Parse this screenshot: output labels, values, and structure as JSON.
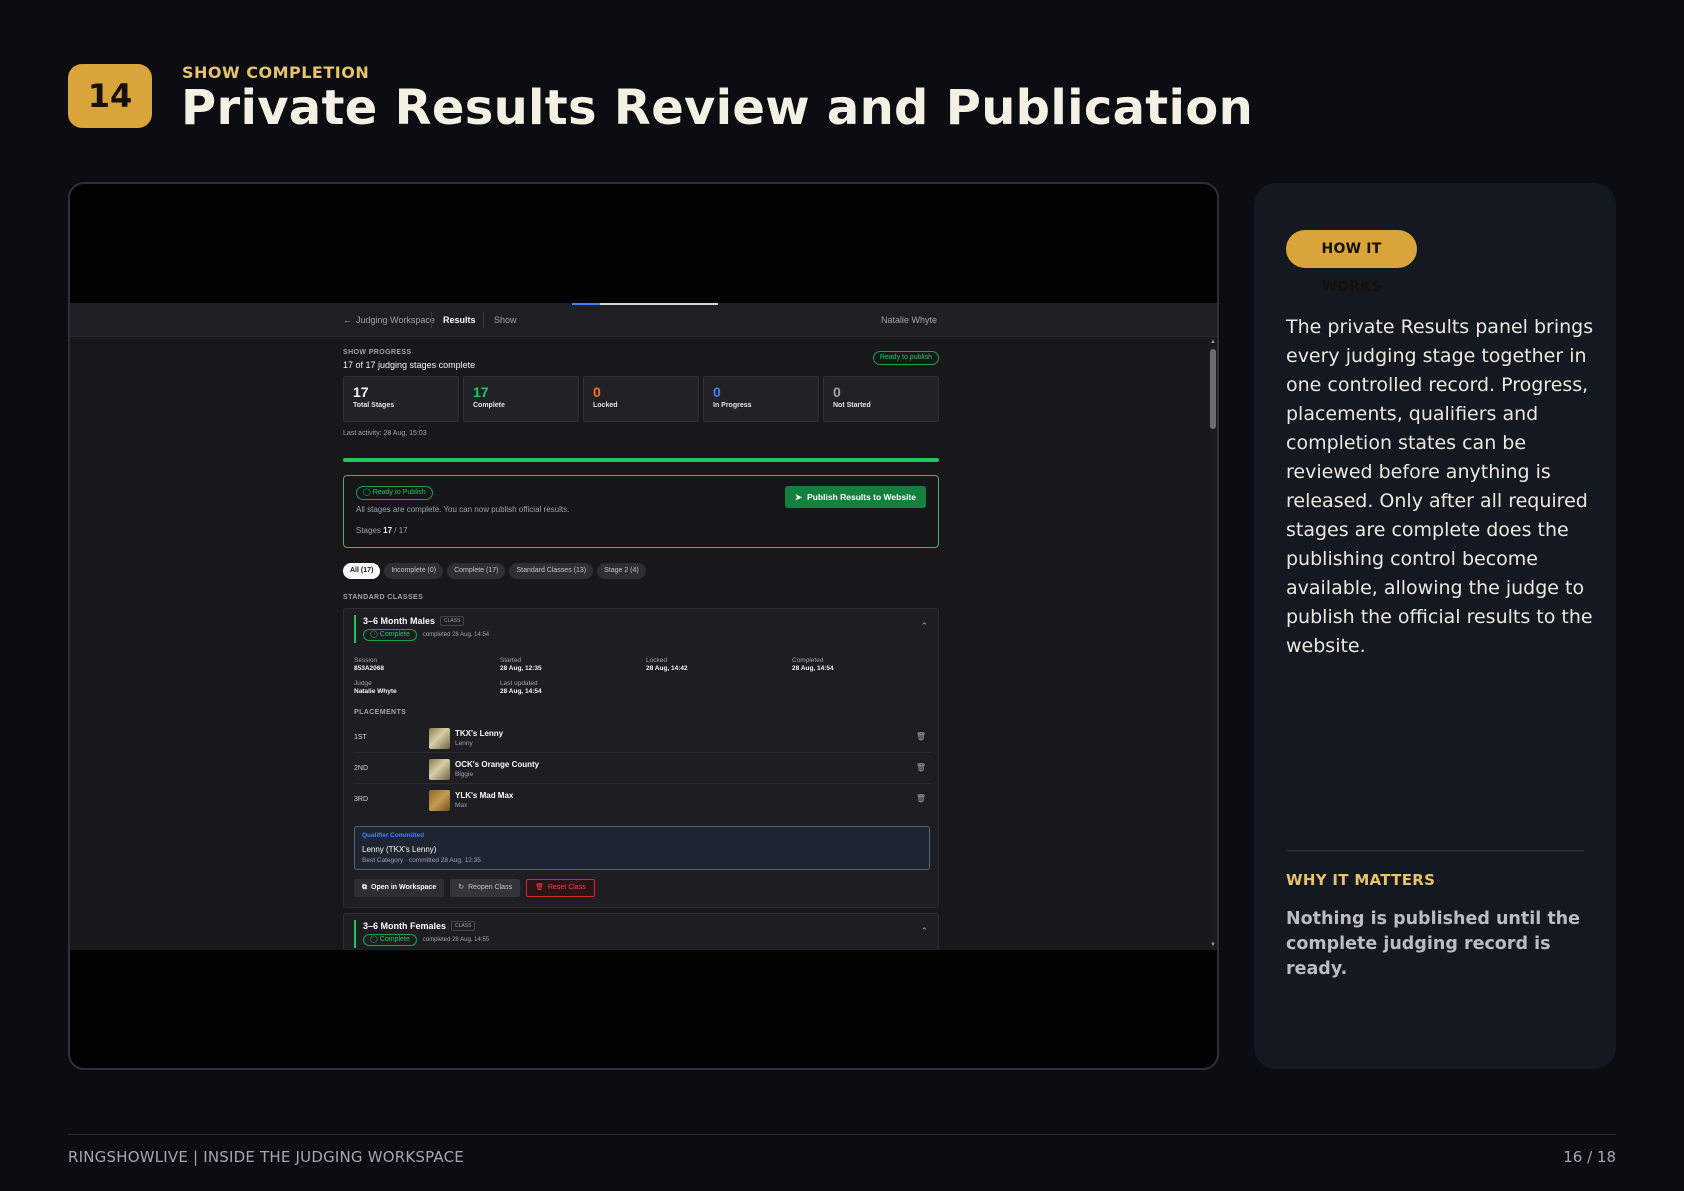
{
  "slide": {
    "number": "14",
    "eyebrow": "SHOW COMPLETION",
    "title": "Private Results Review and Publication"
  },
  "app": {
    "nav": {
      "back_label": "Judging Workspace",
      "results": "Results",
      "show": "Show",
      "user": "Natalie Whyte"
    },
    "progress": {
      "section_label": "SHOW PROGRESS",
      "summary": "17 of 17 judging stages complete",
      "ready_pill": "Ready to publish",
      "percent_complete": 100,
      "stats": [
        {
          "value": "17",
          "label": "Total Stages",
          "color": "#fafafa"
        },
        {
          "value": "17",
          "label": "Complete",
          "color": "#22c55e"
        },
        {
          "value": "0",
          "label": "Locked",
          "color": "#f97316"
        },
        {
          "value": "0",
          "label": "In Progress",
          "color": "#3b82f6"
        },
        {
          "value": "0",
          "label": "Not Started",
          "color": "#a1a1aa"
        }
      ],
      "last_activity": "Last activity: 28 Aug, 15:03"
    },
    "publish": {
      "badge": "Ready to Publish",
      "message": "All stages are complete. You can now publish official results.",
      "stages_prefix": "Stages",
      "stages_done": "17",
      "stages_total": "/ 17",
      "button": "Publish Results to Website"
    },
    "filters": [
      "All (17)",
      "Incomplete (0)",
      "Complete (17)",
      "Standard Classes (13)",
      "Stage 2 (4)"
    ],
    "standard_label": "STANDARD CLASSES",
    "class1": {
      "name": "3–6 Month Males",
      "tag": "CLASS",
      "status": "Complete",
      "completed": "completed 28 Aug, 14:54",
      "meta": {
        "session_k": "Session",
        "session_v": "853A2068",
        "started_k": "Started",
        "started_v": "28 Aug, 12:35",
        "locked_k": "Locked",
        "locked_v": "28 Aug, 14:42",
        "completed_k": "Completed",
        "completed_v": "28 Aug, 14:54",
        "judge_k": "Judge",
        "judge_v": "Natalie Whyte",
        "updated_k": "Last updated",
        "updated_v": "28 Aug, 14:54"
      },
      "placements_label": "PLACEMENTS",
      "placements": [
        {
          "rank": "1ST",
          "name": "TKX's Lenny",
          "sub": "Lenny"
        },
        {
          "rank": "2ND",
          "name": "OCK's Orange County",
          "sub": "Biggie"
        },
        {
          "rank": "3RD",
          "name": "YLK's Mad Max",
          "sub": "Max"
        }
      ],
      "qualifier": {
        "title": "Qualifier Committed",
        "name": "Lenny (TKX's Lenny)",
        "detail": "Best Category · committed 28 Aug, 12:35"
      },
      "actions": {
        "open": "Open in Workspace",
        "reopen": "Reopen Class",
        "reset": "Reset Class"
      }
    },
    "class2": {
      "name": "3–6 Month Females",
      "tag": "CLASS",
      "status": "Complete",
      "completed": "completed 28 Aug, 14:55"
    }
  },
  "panel": {
    "badge": "HOW IT WORKS",
    "description": "The private Results panel brings every judging stage together in one controlled record. Progress, placements, qualifiers and completion states can be reviewed before anything is released. Only after all required stages are complete does the publishing control become available, allowing the judge to publish the official results to the website.",
    "why_label": "WHY IT MATTERS",
    "why_text": "Nothing is published until the complete judging record is ready."
  },
  "footer": {
    "left": "RINGSHOWLIVE | INSIDE THE JUDGING WORKSPACE",
    "right": "16 / 18"
  }
}
